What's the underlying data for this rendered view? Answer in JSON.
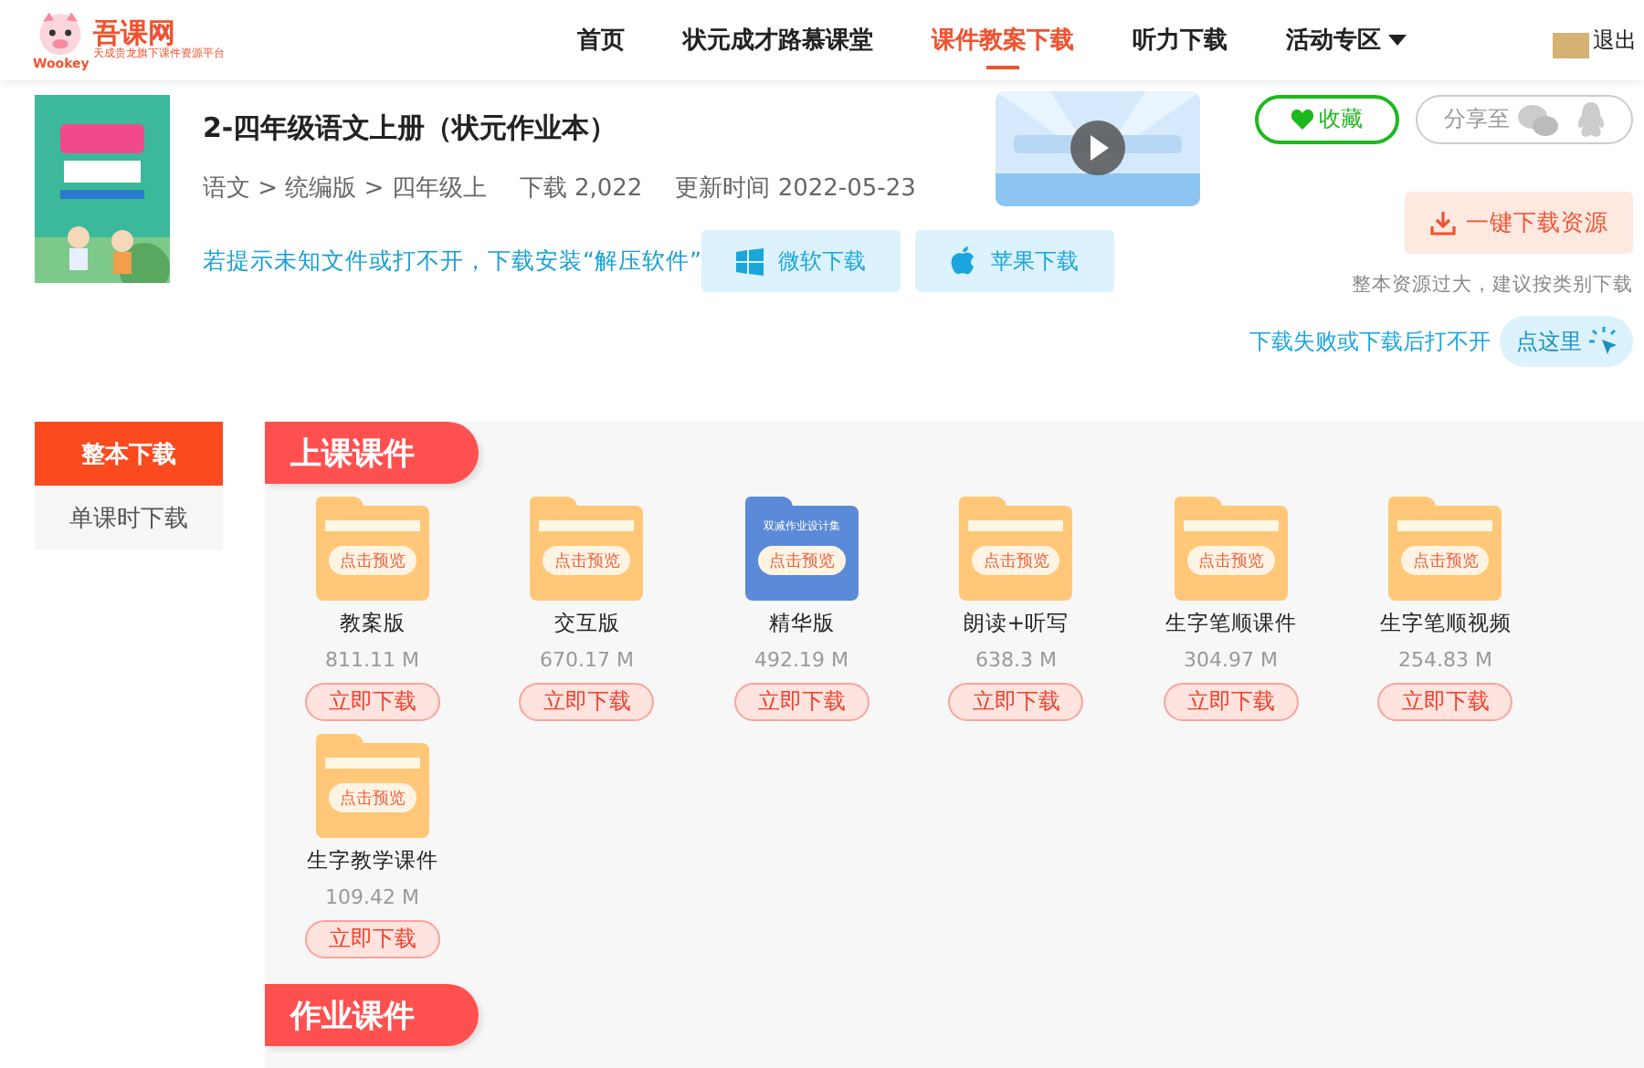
{
  "header": {
    "brand": "吾课网",
    "brand_sub": "Wookey",
    "tagline": "天成贵龙旗下课件资源平台",
    "nav": [
      {
        "label": "首页",
        "selected": false
      },
      {
        "label": "状元成才路慕课堂",
        "selected": false
      },
      {
        "label": "课件教案下载",
        "selected": true
      },
      {
        "label": "听力下载",
        "selected": false
      },
      {
        "label": "活动专区",
        "selected": false,
        "dropdown": true
      }
    ],
    "logout": "退出"
  },
  "resource": {
    "title": "2-四年级语文上册（状元作业本）",
    "breadcrumb": "语文 > 统编版 > 四年级上",
    "downloads_label": "下载",
    "downloads": "2,022",
    "updated_label": "更新时间",
    "updated": "2022-05-23",
    "hint": "若提示未知文件或打不开，下载安装“解压软件”",
    "os_buttons": [
      {
        "kind": "windows",
        "label": "微软下载"
      },
      {
        "kind": "apple",
        "label": "苹果下载"
      }
    ],
    "favorite": "收藏",
    "share": "分享至",
    "download_all": "一键下载资源",
    "note": "整本资源过大，建议按类别下载",
    "fail_text": "下载失败或下载后打不开",
    "fail_button": "点这里"
  },
  "side_tabs": [
    {
      "label": "整本下载",
      "selected": true
    },
    {
      "label": "单课时下载",
      "selected": false
    }
  ],
  "sections": [
    {
      "title": "上课课件",
      "items": [
        {
          "name": "教案版",
          "size": "811.11 M",
          "preview": "点击预览",
          "button": "立即下载",
          "color": "#ffc777"
        },
        {
          "name": "交互版",
          "size": "670.17 M",
          "preview": "点击预览",
          "button": "立即下载",
          "color": "#ffc777"
        },
        {
          "name": "精华版",
          "size": "492.19 M",
          "preview": "点击预览",
          "banner": "双减作业设计集",
          "button": "立即下载",
          "color": "#5b8ad8"
        },
        {
          "name": "朗读+听写",
          "size": "638.3 M",
          "preview": "点击预览",
          "button": "立即下载",
          "color": "#ffc777"
        },
        {
          "name": "生字笔顺课件",
          "size": "304.97 M",
          "preview": "点击预览",
          "button": "立即下载",
          "color": "#ffc777"
        },
        {
          "name": "生字笔顺视频",
          "size": "254.83 M",
          "preview": "点击预览",
          "button": "立即下载",
          "color": "#ffc777"
        },
        {
          "name": "生字教学课件",
          "size": "109.42 M",
          "preview": "点击预览",
          "button": "立即下载",
          "color": "#ffc777"
        }
      ]
    },
    {
      "title": "作业课件"
    }
  ]
}
